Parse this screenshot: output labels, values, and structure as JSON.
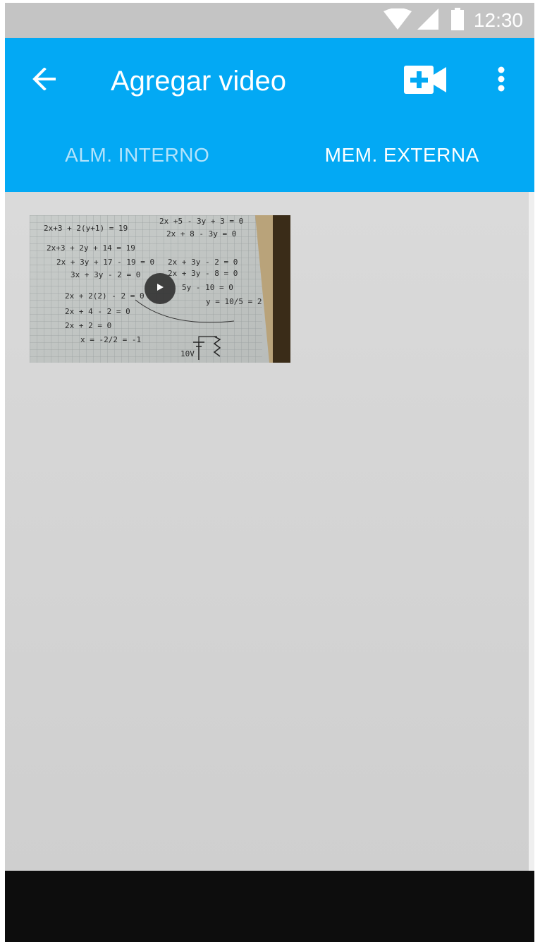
{
  "status_bar": {
    "time": "12:30",
    "icons": [
      "wifi-icon",
      "cell-signal-icon",
      "battery-icon"
    ]
  },
  "toolbar": {
    "title": "Agregar video",
    "back_icon": "arrow-back-icon",
    "add_video_icon": "video-add-icon",
    "overflow_icon": "more-vert-icon"
  },
  "tabs": [
    {
      "label": "ALM. INTERNO",
      "selected": false
    },
    {
      "label": "MEM. EXTERNA",
      "selected": true
    }
  ],
  "videos": [
    {
      "thumbnail": "handwritten-math-notes",
      "play_icon": "play-icon"
    }
  ],
  "colors": {
    "app_bar": "#03a9f4",
    "status_bar": "#c4c4c4",
    "content_bg": "#d8d8d8",
    "nav_bar": "#0d0d0d",
    "tab_inactive_text": "#b3e3fb",
    "tab_active_text": "#ffffff"
  }
}
